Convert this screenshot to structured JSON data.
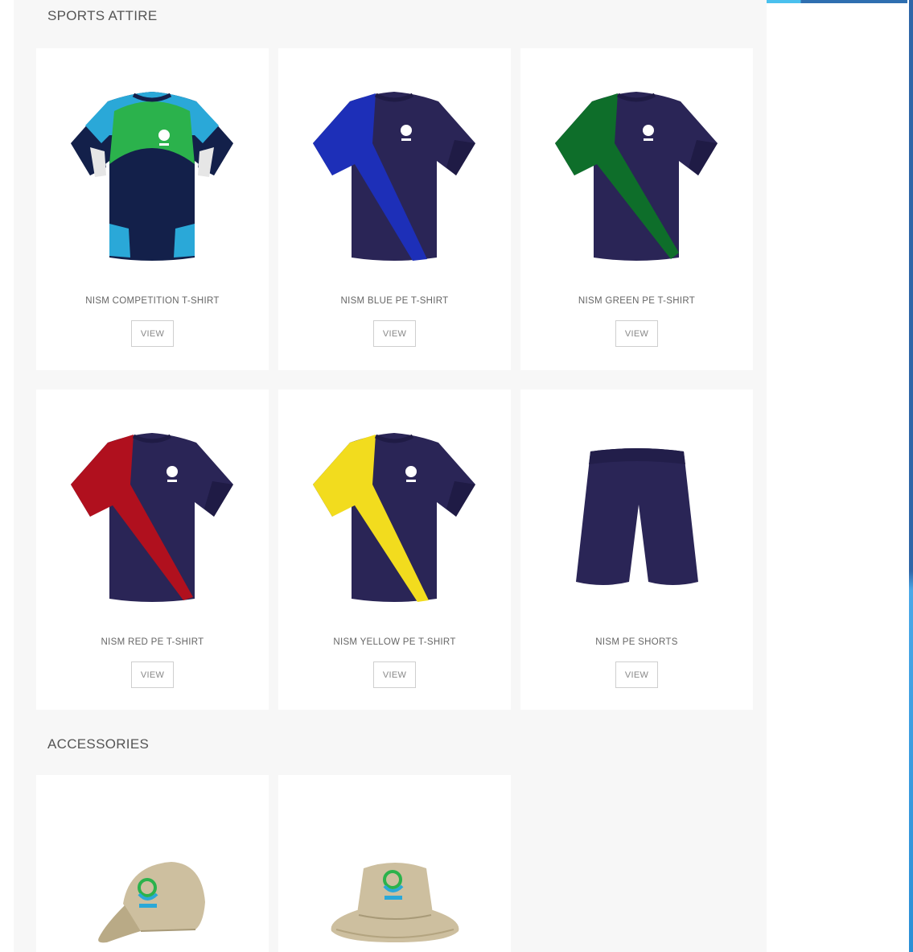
{
  "sections": [
    {
      "title": "SPORTS ATTIRE",
      "products": [
        {
          "name": "NISM COMPETITION T-SHIRT",
          "button": "VIEW"
        },
        {
          "name": "NISM BLUE PE T-SHIRT",
          "button": "VIEW"
        },
        {
          "name": "NISM GREEN PE T-SHIRT",
          "button": "VIEW"
        },
        {
          "name": "NISM RED PE T-SHIRT",
          "button": "VIEW"
        },
        {
          "name": "NISM YELLOW PE T-SHIRT",
          "button": "VIEW"
        },
        {
          "name": "NISM PE SHORTS",
          "button": "VIEW"
        }
      ]
    },
    {
      "title": "ACCESSORIES",
      "products": []
    }
  ],
  "colors": {
    "navy": "#2a2556",
    "competition_navy": "#13204a",
    "competition_green": "#2bb24c",
    "competition_cyan": "#2aa8d8",
    "blue_stripe": "#1d2fb8",
    "green_stripe": "#0e6e2a",
    "red_stripe": "#b0101e",
    "yellow_stripe": "#f2dc1e",
    "cap_khaki": "#cdbf9f"
  },
  "icons": [
    "tshirt-icon",
    "shorts-icon",
    "cap-icon",
    "bucket-hat-icon",
    "logo-icon"
  ]
}
